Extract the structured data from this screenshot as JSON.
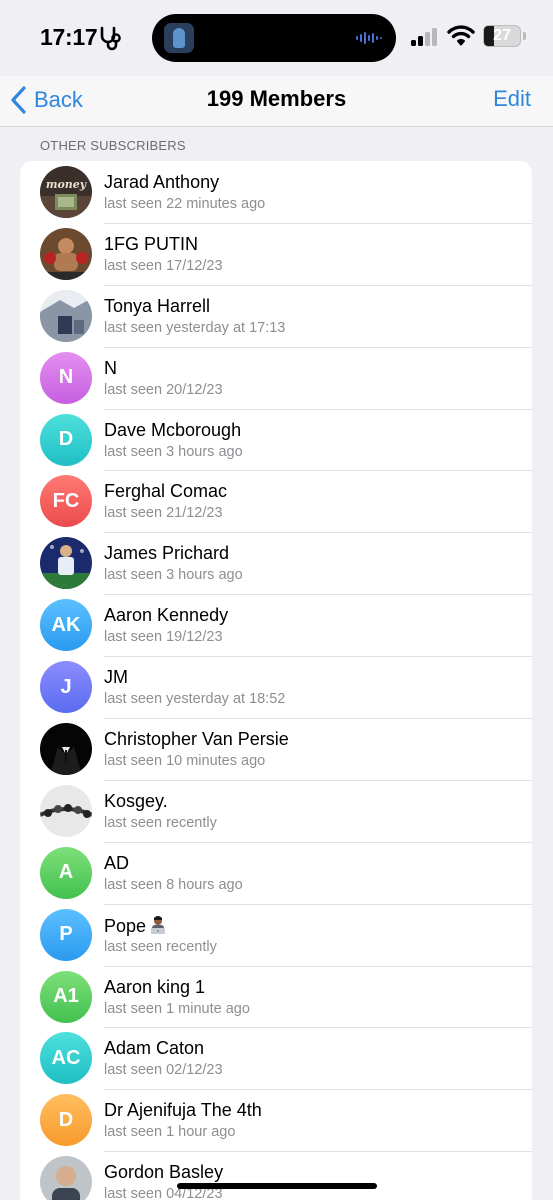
{
  "status_bar": {
    "time": "17:17",
    "battery": "27",
    "battery_level": 0.27
  },
  "nav": {
    "back_label": "Back",
    "title": "199 Members",
    "edit_label": "Edit"
  },
  "section_header": "OTHER SUBSCRIBERS",
  "members": [
    {
      "name": "Jarad Anthony",
      "status": "last seen 22 minutes ago",
      "avatar": {
        "type": "photo",
        "icon": "money-photo"
      }
    },
    {
      "name": "1FG PUTIN",
      "status": "last seen 17/12/23",
      "avatar": {
        "type": "photo",
        "icon": "boxer-photo"
      }
    },
    {
      "name": "Tonya Harrell",
      "status": "last seen yesterday at 17:13",
      "avatar": {
        "type": "photo",
        "icon": "street-photo"
      }
    },
    {
      "name": "N",
      "status": "last seen 20/12/23",
      "avatar": {
        "type": "initials",
        "initials": "N",
        "colors": [
          "#e58ff0",
          "#c45fe0"
        ]
      }
    },
    {
      "name": "Dave Mcborough",
      "status": "last seen 3 hours ago",
      "avatar": {
        "type": "initials",
        "initials": "D",
        "colors": [
          "#4ee0dc",
          "#1fbfc4"
        ]
      }
    },
    {
      "name": "Ferghal Comac",
      "status": "last seen 21/12/23",
      "avatar": {
        "type": "initials",
        "initials": "FC",
        "colors": [
          "#ff7a73",
          "#ec4a4d"
        ]
      }
    },
    {
      "name": "James Prichard",
      "status": "last seen 3 hours ago",
      "avatar": {
        "type": "photo",
        "icon": "football-photo"
      }
    },
    {
      "name": "Aaron Kennedy",
      "status": "last seen 19/12/23",
      "avatar": {
        "type": "initials",
        "initials": "AK",
        "colors": [
          "#5cc0ff",
          "#2a9af0"
        ]
      }
    },
    {
      "name": "JM",
      "status": "last seen yesterday at 18:52",
      "avatar": {
        "type": "initials",
        "initials": "J",
        "colors": [
          "#8c8cff",
          "#5a6cf0"
        ]
      }
    },
    {
      "name": "Christopher Van Persie",
      "status": "last seen 10 minutes ago",
      "avatar": {
        "type": "photo",
        "icon": "suit-photo"
      }
    },
    {
      "name": "Kosgey.",
      "status": "last seen recently",
      "avatar": {
        "type": "photo",
        "icon": "bracelet-photo"
      }
    },
    {
      "name": "AD",
      "status": "last seen 8 hours ago",
      "avatar": {
        "type": "initials",
        "initials": "A",
        "colors": [
          "#7ee07a",
          "#42c050"
        ]
      }
    },
    {
      "name": "Pope",
      "status": "last seen recently",
      "avatar": {
        "type": "initials",
        "initials": "P",
        "colors": [
          "#5cc0ff",
          "#2a9af0"
        ]
      },
      "emoji": "technologist-emoji"
    },
    {
      "name": "Aaron king 1",
      "status": "last seen 1 minute ago",
      "avatar": {
        "type": "initials",
        "initials": "A1",
        "colors": [
          "#7ee07a",
          "#42c050"
        ]
      }
    },
    {
      "name": "Adam Caton",
      "status": "last seen 02/12/23",
      "avatar": {
        "type": "initials",
        "initials": "AC",
        "colors": [
          "#4ee0dc",
          "#1fbfc4"
        ]
      }
    },
    {
      "name": "Dr Ajenifuja The 4th",
      "status": "last seen 1 hour ago",
      "avatar": {
        "type": "initials",
        "initials": "D",
        "colors": [
          "#ffbf60",
          "#f79a2c"
        ]
      }
    },
    {
      "name": "Gordon Basley",
      "status": "last seen 04/12/23",
      "avatar": {
        "type": "photo",
        "icon": "portrait-photo"
      }
    }
  ]
}
